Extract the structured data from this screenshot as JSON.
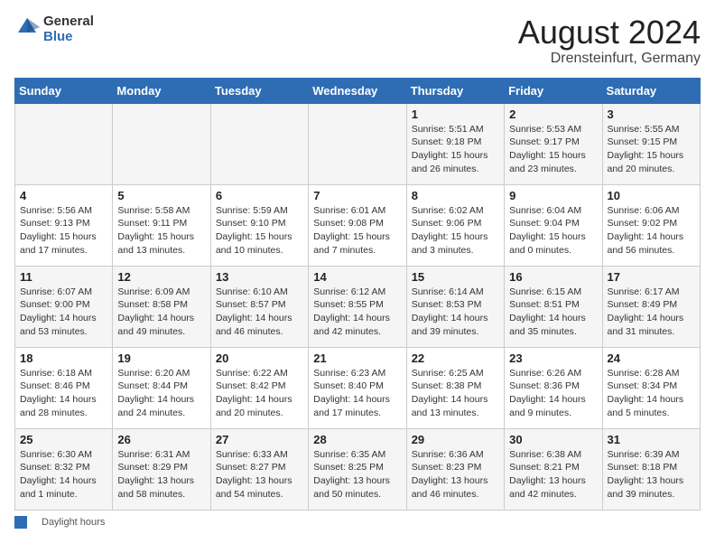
{
  "header": {
    "logo_general": "General",
    "logo_blue": "Blue",
    "title": "August 2024",
    "subtitle": "Drensteinfurt, Germany"
  },
  "calendar": {
    "days_of_week": [
      "Sunday",
      "Monday",
      "Tuesday",
      "Wednesday",
      "Thursday",
      "Friday",
      "Saturday"
    ],
    "weeks": [
      [
        {
          "day": "",
          "info": ""
        },
        {
          "day": "",
          "info": ""
        },
        {
          "day": "",
          "info": ""
        },
        {
          "day": "",
          "info": ""
        },
        {
          "day": "1",
          "info": "Sunrise: 5:51 AM\nSunset: 9:18 PM\nDaylight: 15 hours\nand 26 minutes."
        },
        {
          "day": "2",
          "info": "Sunrise: 5:53 AM\nSunset: 9:17 PM\nDaylight: 15 hours\nand 23 minutes."
        },
        {
          "day": "3",
          "info": "Sunrise: 5:55 AM\nSunset: 9:15 PM\nDaylight: 15 hours\nand 20 minutes."
        }
      ],
      [
        {
          "day": "4",
          "info": "Sunrise: 5:56 AM\nSunset: 9:13 PM\nDaylight: 15 hours\nand 17 minutes."
        },
        {
          "day": "5",
          "info": "Sunrise: 5:58 AM\nSunset: 9:11 PM\nDaylight: 15 hours\nand 13 minutes."
        },
        {
          "day": "6",
          "info": "Sunrise: 5:59 AM\nSunset: 9:10 PM\nDaylight: 15 hours\nand 10 minutes."
        },
        {
          "day": "7",
          "info": "Sunrise: 6:01 AM\nSunset: 9:08 PM\nDaylight: 15 hours\nand 7 minutes."
        },
        {
          "day": "8",
          "info": "Sunrise: 6:02 AM\nSunset: 9:06 PM\nDaylight: 15 hours\nand 3 minutes."
        },
        {
          "day": "9",
          "info": "Sunrise: 6:04 AM\nSunset: 9:04 PM\nDaylight: 15 hours\nand 0 minutes."
        },
        {
          "day": "10",
          "info": "Sunrise: 6:06 AM\nSunset: 9:02 PM\nDaylight: 14 hours\nand 56 minutes."
        }
      ],
      [
        {
          "day": "11",
          "info": "Sunrise: 6:07 AM\nSunset: 9:00 PM\nDaylight: 14 hours\nand 53 minutes."
        },
        {
          "day": "12",
          "info": "Sunrise: 6:09 AM\nSunset: 8:58 PM\nDaylight: 14 hours\nand 49 minutes."
        },
        {
          "day": "13",
          "info": "Sunrise: 6:10 AM\nSunset: 8:57 PM\nDaylight: 14 hours\nand 46 minutes."
        },
        {
          "day": "14",
          "info": "Sunrise: 6:12 AM\nSunset: 8:55 PM\nDaylight: 14 hours\nand 42 minutes."
        },
        {
          "day": "15",
          "info": "Sunrise: 6:14 AM\nSunset: 8:53 PM\nDaylight: 14 hours\nand 39 minutes."
        },
        {
          "day": "16",
          "info": "Sunrise: 6:15 AM\nSunset: 8:51 PM\nDaylight: 14 hours\nand 35 minutes."
        },
        {
          "day": "17",
          "info": "Sunrise: 6:17 AM\nSunset: 8:49 PM\nDaylight: 14 hours\nand 31 minutes."
        }
      ],
      [
        {
          "day": "18",
          "info": "Sunrise: 6:18 AM\nSunset: 8:46 PM\nDaylight: 14 hours\nand 28 minutes."
        },
        {
          "day": "19",
          "info": "Sunrise: 6:20 AM\nSunset: 8:44 PM\nDaylight: 14 hours\nand 24 minutes."
        },
        {
          "day": "20",
          "info": "Sunrise: 6:22 AM\nSunset: 8:42 PM\nDaylight: 14 hours\nand 20 minutes."
        },
        {
          "day": "21",
          "info": "Sunrise: 6:23 AM\nSunset: 8:40 PM\nDaylight: 14 hours\nand 17 minutes."
        },
        {
          "day": "22",
          "info": "Sunrise: 6:25 AM\nSunset: 8:38 PM\nDaylight: 14 hours\nand 13 minutes."
        },
        {
          "day": "23",
          "info": "Sunrise: 6:26 AM\nSunset: 8:36 PM\nDaylight: 14 hours\nand 9 minutes."
        },
        {
          "day": "24",
          "info": "Sunrise: 6:28 AM\nSunset: 8:34 PM\nDaylight: 14 hours\nand 5 minutes."
        }
      ],
      [
        {
          "day": "25",
          "info": "Sunrise: 6:30 AM\nSunset: 8:32 PM\nDaylight: 14 hours\nand 1 minute."
        },
        {
          "day": "26",
          "info": "Sunrise: 6:31 AM\nSunset: 8:29 PM\nDaylight: 13 hours\nand 58 minutes."
        },
        {
          "day": "27",
          "info": "Sunrise: 6:33 AM\nSunset: 8:27 PM\nDaylight: 13 hours\nand 54 minutes."
        },
        {
          "day": "28",
          "info": "Sunrise: 6:35 AM\nSunset: 8:25 PM\nDaylight: 13 hours\nand 50 minutes."
        },
        {
          "day": "29",
          "info": "Sunrise: 6:36 AM\nSunset: 8:23 PM\nDaylight: 13 hours\nand 46 minutes."
        },
        {
          "day": "30",
          "info": "Sunrise: 6:38 AM\nSunset: 8:21 PM\nDaylight: 13 hours\nand 42 minutes."
        },
        {
          "day": "31",
          "info": "Sunrise: 6:39 AM\nSunset: 8:18 PM\nDaylight: 13 hours\nand 39 minutes."
        }
      ]
    ]
  },
  "footer": {
    "label": "Daylight hours"
  }
}
